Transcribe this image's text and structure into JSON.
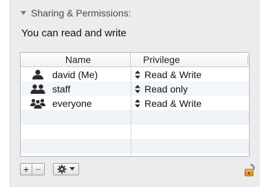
{
  "section": {
    "title": "Sharing & Permissions:",
    "disclosure_icon": "disclosure-triangle-down-icon",
    "status_text": "You can read and write"
  },
  "table": {
    "columns": {
      "name": "Name",
      "privilege": "Privilege"
    },
    "rows": [
      {
        "name": "david (Me)",
        "privilege": "Read & Write",
        "icon": "single-user-icon"
      },
      {
        "name": "staff",
        "privilege": "Read only",
        "icon": "group-icon"
      },
      {
        "name": "everyone",
        "privilege": "Read & Write",
        "icon": "everyone-icon"
      }
    ]
  },
  "toolbar": {
    "add_label": "+",
    "remove_label": "−",
    "action_icon": "gear-icon",
    "lock_icon": "lock-icon"
  },
  "colors": {
    "panel_bg": "#ececec",
    "row_alt": "#f3f6fa",
    "border": "#b9b9b9"
  }
}
